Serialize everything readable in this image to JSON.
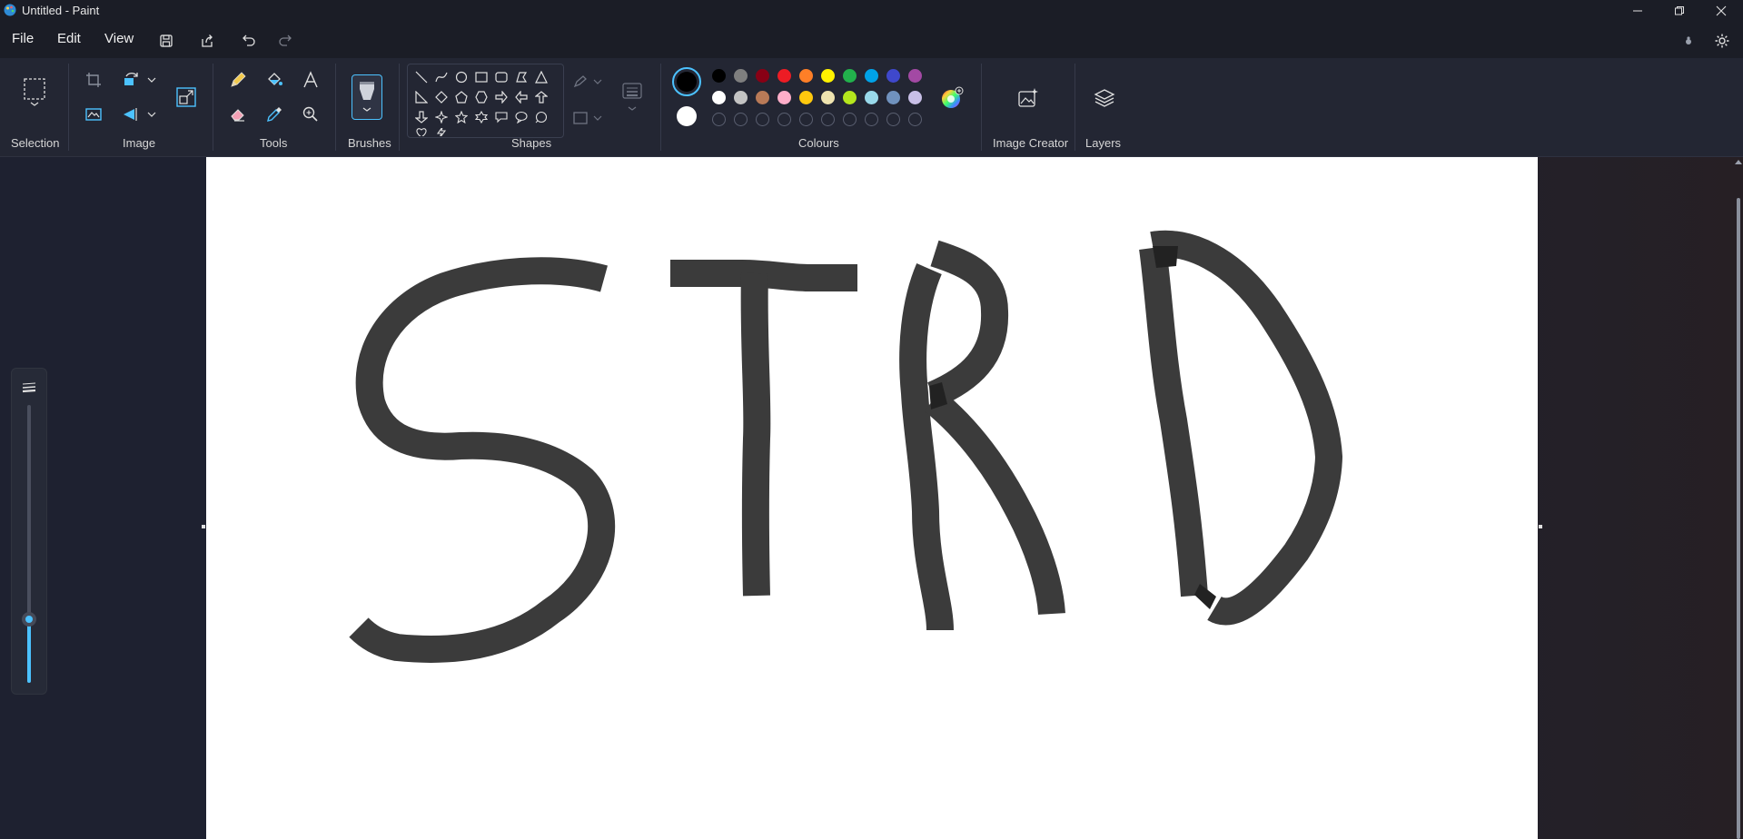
{
  "window": {
    "title": "Untitled - Paint",
    "app_icon": "paint-palette-icon",
    "controls": [
      "minimize-icon",
      "restore-icon",
      "close-icon"
    ]
  },
  "menu": {
    "file": "File",
    "edit": "Edit",
    "view": "View",
    "quick_actions": [
      "save-icon",
      "share-icon",
      "undo-icon",
      "redo-icon"
    ],
    "right_icons": [
      "copilot-icon",
      "settings-gear-icon"
    ]
  },
  "ribbon": {
    "groups": {
      "selection": "Selection",
      "image": "Image",
      "tools": "Tools",
      "brushes": "Brushes",
      "shapes": "Shapes",
      "colours": "Colours",
      "image_creator": "Image Creator",
      "layers": "Layers"
    },
    "image_tools": [
      "crop-icon",
      "rotate-icon",
      "background-remove-icon",
      "flip-icon",
      "resize-icon"
    ],
    "tool_icons": [
      "pencil-icon",
      "fill-bucket-icon",
      "text-icon",
      "eraser-icon",
      "color-picker-icon",
      "magnifier-icon"
    ],
    "shape_icons": [
      "line",
      "curve",
      "oval",
      "rectangle",
      "rounded-rectangle",
      "polygon",
      "triangle",
      "right-triangle",
      "diamond",
      "pentagon",
      "hexagon",
      "right-arrow",
      "left-arrow",
      "up-arrow",
      "down-arrow",
      "four-point-star",
      "five-point-star",
      "six-point-star",
      "rect-callout",
      "oval-callout",
      "cloud-callout"
    ]
  },
  "colours": {
    "primary": "#000000",
    "secondary": "#ffffff",
    "palette_row1": [
      "#000000",
      "#7f7f7f",
      "#880015",
      "#ed1c24",
      "#ff7f27",
      "#fff200",
      "#22b14c",
      "#00a2e8",
      "#3f48cc",
      "#a349a4"
    ],
    "palette_row2": [
      "#ffffff",
      "#c3c3c3",
      "#b97a57",
      "#ffaec9",
      "#ffc90e",
      "#efe4b0",
      "#b5e61d",
      "#99d9ea",
      "#7092be",
      "#c8bfe7"
    ],
    "custom_slots": 10,
    "accent": "#4cc2ff"
  },
  "canvas": {
    "background": "#ffffff",
    "stroke_color": "#3b3b3b",
    "drawn_letters": [
      "S",
      "T",
      "R",
      "D"
    ]
  },
  "brush_size_slider": {
    "icon": "brush-size-icon",
    "value_fraction": 0.23
  }
}
